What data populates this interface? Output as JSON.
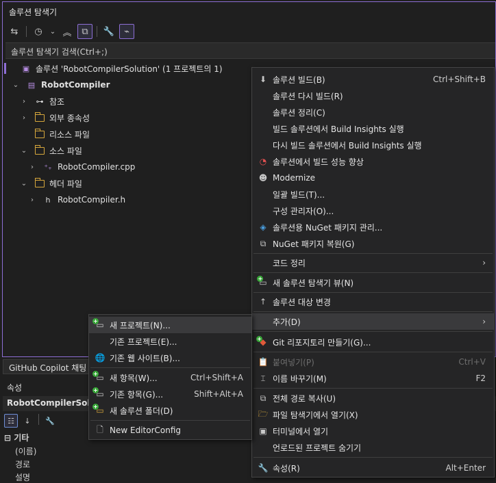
{
  "solution_explorer": {
    "title": "솔루션 탐색기",
    "search_placeholder": "솔루션 탐색기 검색(Ctrl+;)",
    "tree": {
      "solution_label": "솔루션 'RobotCompilerSolution' (1 프로젝트의 1)",
      "project": "RobotCompiler",
      "references": "참조",
      "external_deps": "외부 종속성",
      "resource_files": "리소스 파일",
      "source_files": "소스 파일",
      "source_cpp": "RobotCompiler.cpp",
      "header_files": "헤더 파일",
      "header_h": "RobotCompiler.h"
    }
  },
  "bottom_tab": {
    "label": "GitHub Copilot 채팅"
  },
  "properties": {
    "title": "속성",
    "object": "RobotCompilerSolutio",
    "category": "기타",
    "rows": [
      "(이름)",
      "경로",
      "설명"
    ]
  },
  "context_menu": {
    "items": [
      {
        "label": "솔루션 빌드(B)",
        "shortcut": "Ctrl+Shift+B"
      },
      {
        "label": "솔루션 다시 빌드(R)",
        "shortcut": ""
      },
      {
        "label": "솔루션 정리(C)",
        "shortcut": ""
      },
      {
        "label": "빌드 솔루션에서 Build Insights 실행",
        "shortcut": ""
      },
      {
        "label": "다시 빌드 솔루션에서 Build Insights 실행",
        "shortcut": ""
      },
      {
        "label": "솔루션에서 빌드 성능 향상",
        "shortcut": ""
      },
      {
        "label": "Modernize",
        "shortcut": ""
      },
      {
        "label": "일괄 빌드(T)...",
        "shortcut": ""
      },
      {
        "label": "구성 관리자(O)...",
        "shortcut": ""
      },
      {
        "label": "솔루션용 NuGet 패키지 관리...",
        "shortcut": ""
      },
      {
        "label": "NuGet 패키지 복원(G)",
        "shortcut": ""
      },
      {
        "label": "코드 정리",
        "shortcut": ""
      },
      {
        "label": "새 솔루션 탐색기 뷰(N)",
        "shortcut": ""
      },
      {
        "label": "솔루션 대상 변경",
        "shortcut": ""
      },
      {
        "label": "추가(D)",
        "shortcut": ""
      },
      {
        "label": "Git 리포지토리 만들기(G)...",
        "shortcut": ""
      },
      {
        "label": "붙여넣기(P)",
        "shortcut": "Ctrl+V"
      },
      {
        "label": "이름 바꾸기(M)",
        "shortcut": "F2"
      },
      {
        "label": "전체 경로 복사(U)",
        "shortcut": ""
      },
      {
        "label": "파일 탐색기에서 열기(X)",
        "shortcut": ""
      },
      {
        "label": "터미널에서 열기",
        "shortcut": ""
      },
      {
        "label": "언로드된 프로젝트 숨기기",
        "shortcut": ""
      },
      {
        "label": "속성(R)",
        "shortcut": "Alt+Enter"
      }
    ]
  },
  "add_submenu": {
    "items": [
      {
        "label": "새 프로젝트(N)...",
        "shortcut": ""
      },
      {
        "label": "기존 프로젝트(E)...",
        "shortcut": ""
      },
      {
        "label": "기존 웹 사이트(B)...",
        "shortcut": ""
      },
      {
        "label": "새 항목(W)...",
        "shortcut": "Ctrl+Shift+A"
      },
      {
        "label": "기존 항목(G)...",
        "shortcut": "Shift+Alt+A"
      },
      {
        "label": "새 솔루션 폴더(D)",
        "shortcut": ""
      },
      {
        "label": "New EditorConfig",
        "shortcut": ""
      }
    ]
  },
  "colors": {
    "accent": "#8e6fd6",
    "menu_bg": "#252526",
    "highlight": "#3a3a3c",
    "folder": "#d8a83c",
    "add_green": "#3aa83a"
  }
}
